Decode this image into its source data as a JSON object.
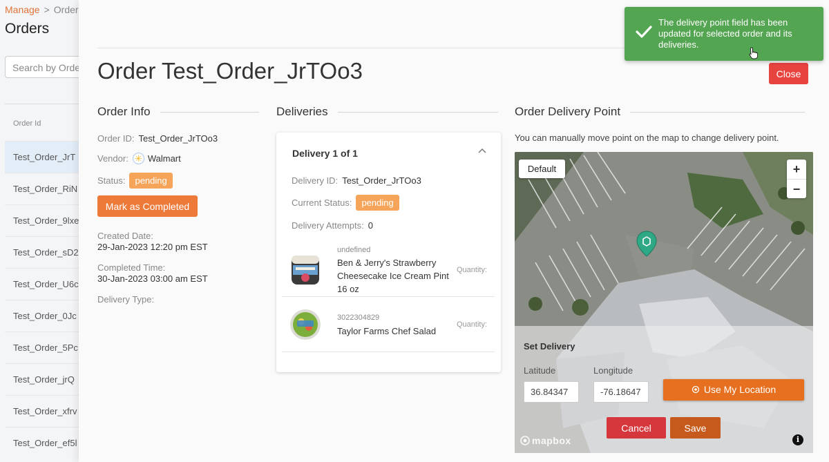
{
  "background": {
    "breadcrumb": {
      "root": "Manage",
      "separator": ">",
      "current": "Order"
    },
    "title": "Orders",
    "search_placeholder": "Search by Orde",
    "column_header": "Order Id",
    "rows": [
      "Test_Order_JrT",
      "Test_Order_RiN",
      "Test_Order_9lxe",
      "Test_Order_sD2",
      "Test_Order_U6c",
      "Test_Order_0Jc",
      "Test_Order_5Pc",
      "Test_Order_jrQ",
      "Test_Order_xfrv",
      "Test_Order_ef5l"
    ]
  },
  "modal": {
    "title": "Order Test_Order_JrTOo3",
    "close_label": "Close",
    "order_info": {
      "heading": "Order Info",
      "order_id_label": "Order ID:",
      "order_id": "Test_Order_JrTOo3",
      "vendor_label": "Vendor:",
      "vendor": "Walmart",
      "status_label": "Status:",
      "status": "pending",
      "mark_completed_label": "Mark as Completed",
      "created_label": "Created Date:",
      "created_value": "29-Jan-2023 12:20 pm EST",
      "completed_label": "Completed Time:",
      "completed_value": "30-Jan-2023 03:00 am EST",
      "delivery_type_label": "Delivery Type:"
    },
    "deliveries": {
      "heading": "Deliveries",
      "card_title": "Delivery 1 of 1",
      "delivery_id_label": "Delivery ID:",
      "delivery_id": "Test_Order_JrTOo3",
      "current_status_label": "Current Status:",
      "current_status": "pending",
      "attempts_label": "Delivery Attempts:",
      "attempts": "0",
      "items": [
        {
          "code": "undefined",
          "name": "Ben & Jerry's Strawberry Cheesecake Ice Cream Pint 16 oz",
          "qty_label": "Quantity:"
        },
        {
          "code": "3022304829",
          "name": "Taylor Farms Chef Salad",
          "qty_label": "Quantity:"
        }
      ]
    },
    "delivery_point": {
      "heading": "Order Delivery Point",
      "description": "You can manually move point on the map to change delivery point.",
      "default_label": "Default",
      "zoom_in": "+",
      "zoom_out": "−",
      "set_delivery_title": "Set Delivery",
      "latitude_label": "Latitude",
      "longitude_label": "Longitude",
      "latitude": "36.84347",
      "longitude": "-76.18647",
      "use_location_label": "Use My Location",
      "cancel_label": "Cancel",
      "save_label": "Save",
      "map_logo": "mapbox",
      "info_glyph": "i"
    }
  },
  "toast": {
    "message": "The delivery point field has been updated for selected order and its deliveries."
  },
  "colors": {
    "accent_orange": "#ee7a3a",
    "status_badge": "#f7a45b",
    "close_red": "#e8443f",
    "toast_green": "#54a552"
  }
}
